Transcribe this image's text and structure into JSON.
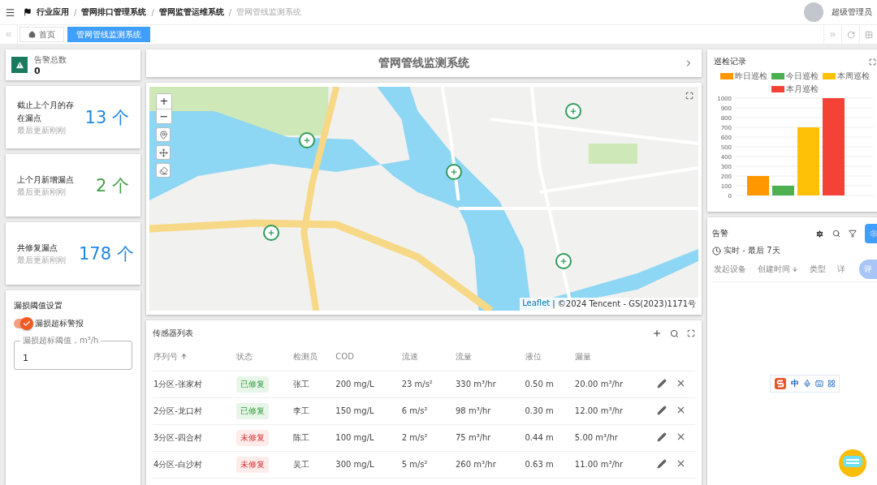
{
  "header": {
    "separator": "/",
    "breadcrumbs": [
      {
        "label": "行业应用",
        "current": false
      },
      {
        "label": "管网排口管理系统",
        "current": false
      },
      {
        "label": "管网监管运维系统",
        "current": false
      },
      {
        "label": "管网管线监测系统",
        "current": true
      }
    ],
    "user": "超级管理员"
  },
  "tabs": [
    {
      "label": "首页",
      "selected": false
    },
    {
      "label": "管网管线监测系统",
      "selected": true
    }
  ],
  "alert_total": {
    "label": "告警总数",
    "value": "0"
  },
  "stats": [
    {
      "title": "截止上个月的存在漏点",
      "subtitle": "最后更新刚刚",
      "value": "13 个",
      "color": "#1e88e5"
    },
    {
      "title": "上个月新增漏点",
      "subtitle": "最后更新刚刚",
      "value": "2 个",
      "color": "#43a047"
    },
    {
      "title": "共修复漏点",
      "subtitle": "最后更新刚刚",
      "value": "178 个",
      "color": "#1e88e5"
    }
  ],
  "settings": {
    "title": "漏损阈值设置",
    "switch": {
      "label": "漏损超标警报",
      "on": true
    },
    "field": {
      "label": "漏损超标阈值，m³/h",
      "value": "1"
    }
  },
  "center_title": "管网管线监测系统",
  "map": {
    "zoom_in": "+",
    "zoom_out": "−",
    "attribution_link": "Leaflet",
    "attribution": "| ©2024 Tencent - GS(2023)1171号"
  },
  "sensors": {
    "title": "传感器列表",
    "columns": [
      "序列号",
      "状态",
      "检测员",
      "COD",
      "流速",
      "流量",
      "液位",
      "漏量"
    ],
    "rows": [
      {
        "id": "1分区-张家村",
        "status": {
          "text": "已修复",
          "kind": "ok"
        },
        "inspector": "张工",
        "cod": "200 mg/L",
        "speed": "23 m/s²",
        "flow": "330 m³/hr",
        "level": "0.50 m",
        "leak": "20.00 m³/hr"
      },
      {
        "id": "2分区-龙口村",
        "status": {
          "text": "已修复",
          "kind": "ok"
        },
        "inspector": "李工",
        "cod": "150 mg/L",
        "speed": "6 m/s²",
        "flow": "98 m³/hr",
        "level": "0.30 m",
        "leak": "12.00 m³/hr"
      },
      {
        "id": "3分区-四合村",
        "status": {
          "text": "未修复",
          "kind": "bad"
        },
        "inspector": "陈工",
        "cod": "100 mg/L",
        "speed": "2 m/s²",
        "flow": "75 m³/hr",
        "level": "0.44 m",
        "leak": "5.00 m³/hr"
      },
      {
        "id": "4分区-白沙村",
        "status": {
          "text": "未修复",
          "kind": "bad"
        },
        "inspector": "吴工",
        "cod": "300 mg/L",
        "speed": "5 m/s²",
        "flow": "260 m³/hr",
        "level": "0.63 m",
        "leak": "11.00 m³/hr"
      }
    ]
  },
  "patrol": {
    "title": "巡检记录",
    "chart_data": {
      "type": "bar",
      "grid": true,
      "legend": true,
      "series": [
        {
          "name": "昨日巡检",
          "color": "#ff9800",
          "values": [
            200
          ]
        },
        {
          "name": "今日巡检",
          "color": "#4caf50",
          "values": [
            100
          ]
        },
        {
          "name": "本周巡检",
          "color": "#ffc107",
          "values": [
            700
          ]
        },
        {
          "name": "本月巡检",
          "color": "#f44336",
          "values": [
            1000
          ]
        }
      ],
      "ylim": [
        0,
        1000
      ],
      "yticks": [
        0,
        100,
        200,
        300,
        400,
        500,
        600,
        700,
        800,
        900,
        1000
      ]
    }
  },
  "alerts": {
    "title": "告警",
    "range": "实时 - 最后 7天",
    "columns": [
      "发起设备",
      "创建时间",
      "类型",
      "详"
    ]
  },
  "float_button": "评",
  "ime": {
    "mode": "中"
  }
}
